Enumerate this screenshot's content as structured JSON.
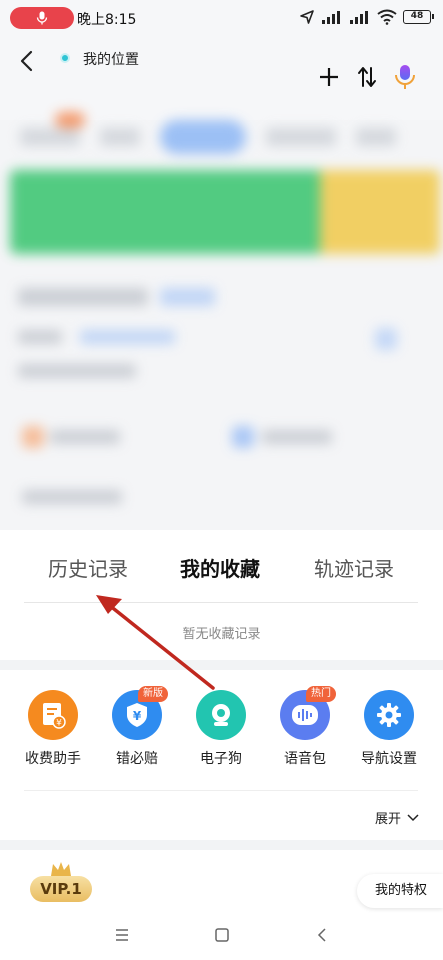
{
  "status_bar": {
    "time": "晚上8:15",
    "battery": "48"
  },
  "header": {
    "location": "我的位置"
  },
  "tabs": [
    {
      "label": "历史记录"
    },
    {
      "label": "我的收藏"
    },
    {
      "label": "轨迹记录"
    }
  ],
  "empty_text": "暂无收藏记录",
  "tools": [
    {
      "label": "收费助手",
      "icon": "toll-assistant-icon",
      "color": "#f58a1f",
      "badge": ""
    },
    {
      "label": "错必赔",
      "icon": "compensation-shield-icon",
      "color": "#2f8cf0",
      "badge": "新版"
    },
    {
      "label": "电子狗",
      "icon": "camera-icon",
      "color": "#22c5b0",
      "badge": ""
    },
    {
      "label": "语音包",
      "icon": "voice-pack-icon",
      "color": "#5b7df0",
      "badge": "热门"
    },
    {
      "label": "导航设置",
      "icon": "gear-icon",
      "color": "#2f8cf0",
      "badge": ""
    }
  ],
  "expand_label": "展开",
  "vip_label": "VIP.1",
  "my_privileges": "我的特权",
  "colors": {
    "arrow": "#c0281f",
    "primary_blue": "#2f8cf0"
  }
}
